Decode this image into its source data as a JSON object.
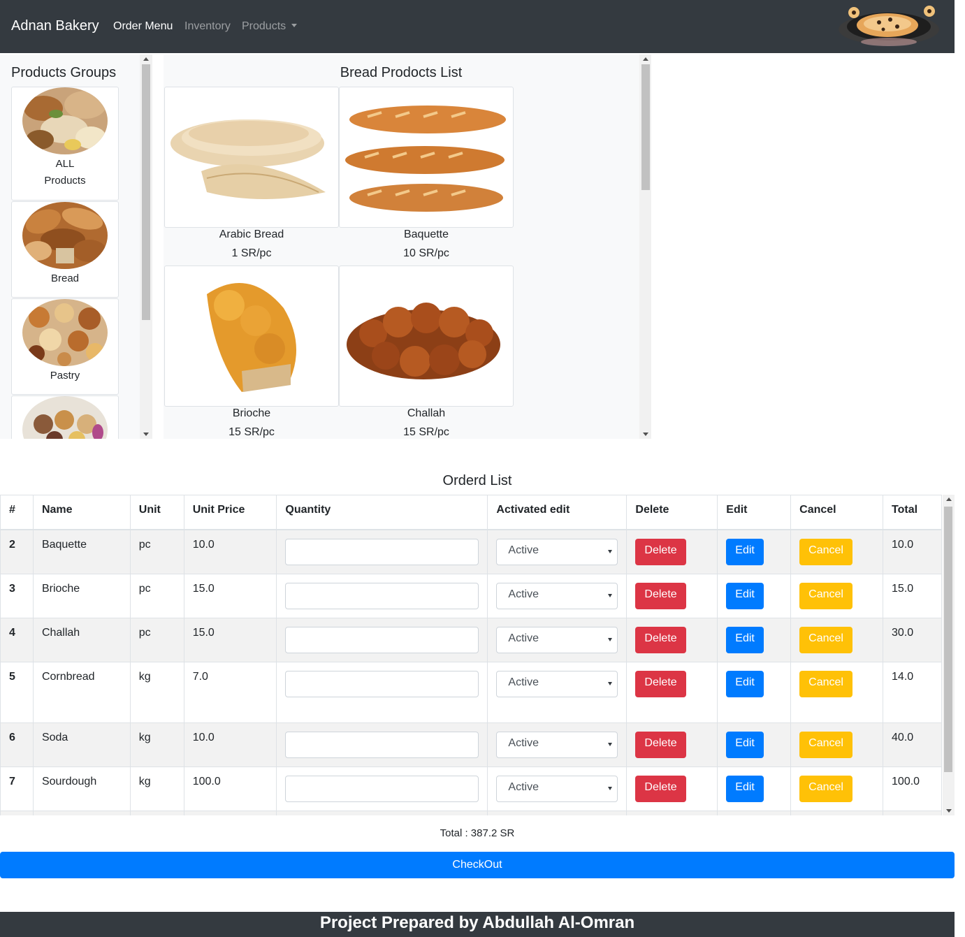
{
  "navbar": {
    "brand": "Adnan Bakery",
    "links": [
      "Order Menu",
      "Inventory",
      "Products"
    ]
  },
  "groups": {
    "title": "Products Groups",
    "items": [
      {
        "line1": "ALL",
        "line2": "Products"
      },
      {
        "line1": "Bread"
      },
      {
        "line1": "Pastry"
      },
      {
        "line1": ""
      }
    ]
  },
  "products": {
    "title": "Bread Prodocts List",
    "items": [
      {
        "name": "Arabic Bread",
        "price": "1 SR/pc"
      },
      {
        "name": "Baquette",
        "price": "10 SR/pc"
      },
      {
        "name": "Brioche",
        "price": "15 SR/pc"
      },
      {
        "name": "Challah",
        "price": "15 SR/pc"
      }
    ]
  },
  "order": {
    "title": "Orderd List",
    "headers": [
      "#",
      "Name",
      "Unit",
      "Unit Price",
      "Quantity",
      "Activated edit",
      "Delete",
      "Edit",
      "Cancel",
      "Total"
    ],
    "select_value": "Active",
    "delete_label": "Delete",
    "edit_label": "Edit",
    "cancel_label": "Cancel",
    "rows": [
      {
        "num": "2",
        "name": "Baquette",
        "unit": "pc",
        "price": "10.0",
        "total": "10.0"
      },
      {
        "num": "3",
        "name": "Brioche",
        "unit": "pc",
        "price": "15.0",
        "total": "15.0"
      },
      {
        "num": "4",
        "name": "Challah",
        "unit": "pc",
        "price": "15.0",
        "total": "30.0"
      },
      {
        "num": "5",
        "name": "Cornbread",
        "unit": "kg",
        "price": "7.0",
        "total": "14.0"
      },
      {
        "num": "6",
        "name": "Soda",
        "unit": "kg",
        "price": "10.0",
        "total": "40.0"
      },
      {
        "num": "7",
        "name": "Sourdough",
        "unit": "kg",
        "price": "100.0",
        "total": "100.0"
      }
    ],
    "total_text": "Total : 387.2 SR",
    "checkout_label": "CheckOut"
  },
  "footer": {
    "text": "Project Prepared by Abdullah Al-Omran"
  },
  "colors": {
    "navbar": "#343a40",
    "primary": "#007bff",
    "danger": "#dc3545",
    "warning": "#ffc107"
  }
}
